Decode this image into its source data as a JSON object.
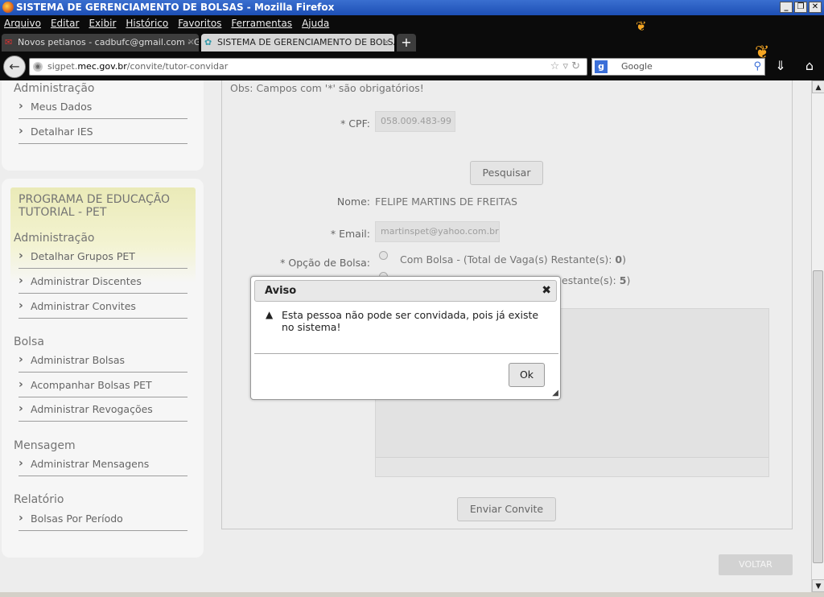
{
  "window": {
    "title": "SISTEMA DE GERENCIAMENTO DE BOLSAS - Mozilla Firefox",
    "controls": [
      "_",
      "❐",
      "✕"
    ]
  },
  "menu": [
    "Arquivo",
    "Editar",
    "Exibir",
    "Histórico",
    "Favoritos",
    "Ferramentas",
    "Ajuda"
  ],
  "tabs": [
    {
      "label": "Novos petianos - cadbufc@gmail.com - G...",
      "icon": "gmail-icon"
    },
    {
      "label": "SISTEMA DE GERENCIAMENTO DE BOLSAS",
      "icon": "site-icon"
    }
  ],
  "newtab_label": "+",
  "url": {
    "prefix": "sigpet.",
    "domain": "mec.gov.br",
    "path": "/convite/tutor-convidar"
  },
  "search": {
    "engine": "Google"
  },
  "sidebar": {
    "top_section": "Administração",
    "top_items": [
      "Meus Dados",
      "Detalhar IES"
    ],
    "program_title": "PROGRAMA DE EDUCAÇÃO TUTORIAL - PET",
    "admin_section": "Administração",
    "admin_items": [
      "Detalhar Grupos PET",
      "Administrar Discentes",
      "Administrar Convites"
    ],
    "bolsa_section": "Bolsa",
    "bolsa_items": [
      "Administrar Bolsas",
      "Acompanhar Bolsas PET",
      "Administrar Revogações"
    ],
    "msg_section": "Mensagem",
    "msg_items": [
      "Administrar Mensagens"
    ],
    "rel_section": "Relatório",
    "rel_items": [
      "Bolsas Por Período"
    ]
  },
  "form": {
    "obs": "Obs: Campos com '*' são obrigatórios!",
    "cpf_label": "* CPF:",
    "cpf_value": "058.009.483-99",
    "search_button": "Pesquisar",
    "name_label": "Nome:",
    "name_value": "FELIPE MARTINS DE FREITAS",
    "email_label": "* Email:",
    "email_value": "martinspet@yahoo.com.br",
    "bolsa_label": "* Opção de Bolsa:",
    "option1_prefix": "Com Bolsa - (Total de Vaga(s) Restante(s): ",
    "option1_count": "0",
    "option1_suffix": ")",
    "option2_partial": "estante(s): ",
    "option2_count": "5",
    "option2_suffix": ")",
    "send_button": "Enviar Convite",
    "back_button": "VOLTAR"
  },
  "dialog": {
    "title": "Aviso",
    "close": "✖",
    "message": "Esta pessoa não pode ser convidada, pois já existe no sistema!",
    "ok": "Ok"
  }
}
